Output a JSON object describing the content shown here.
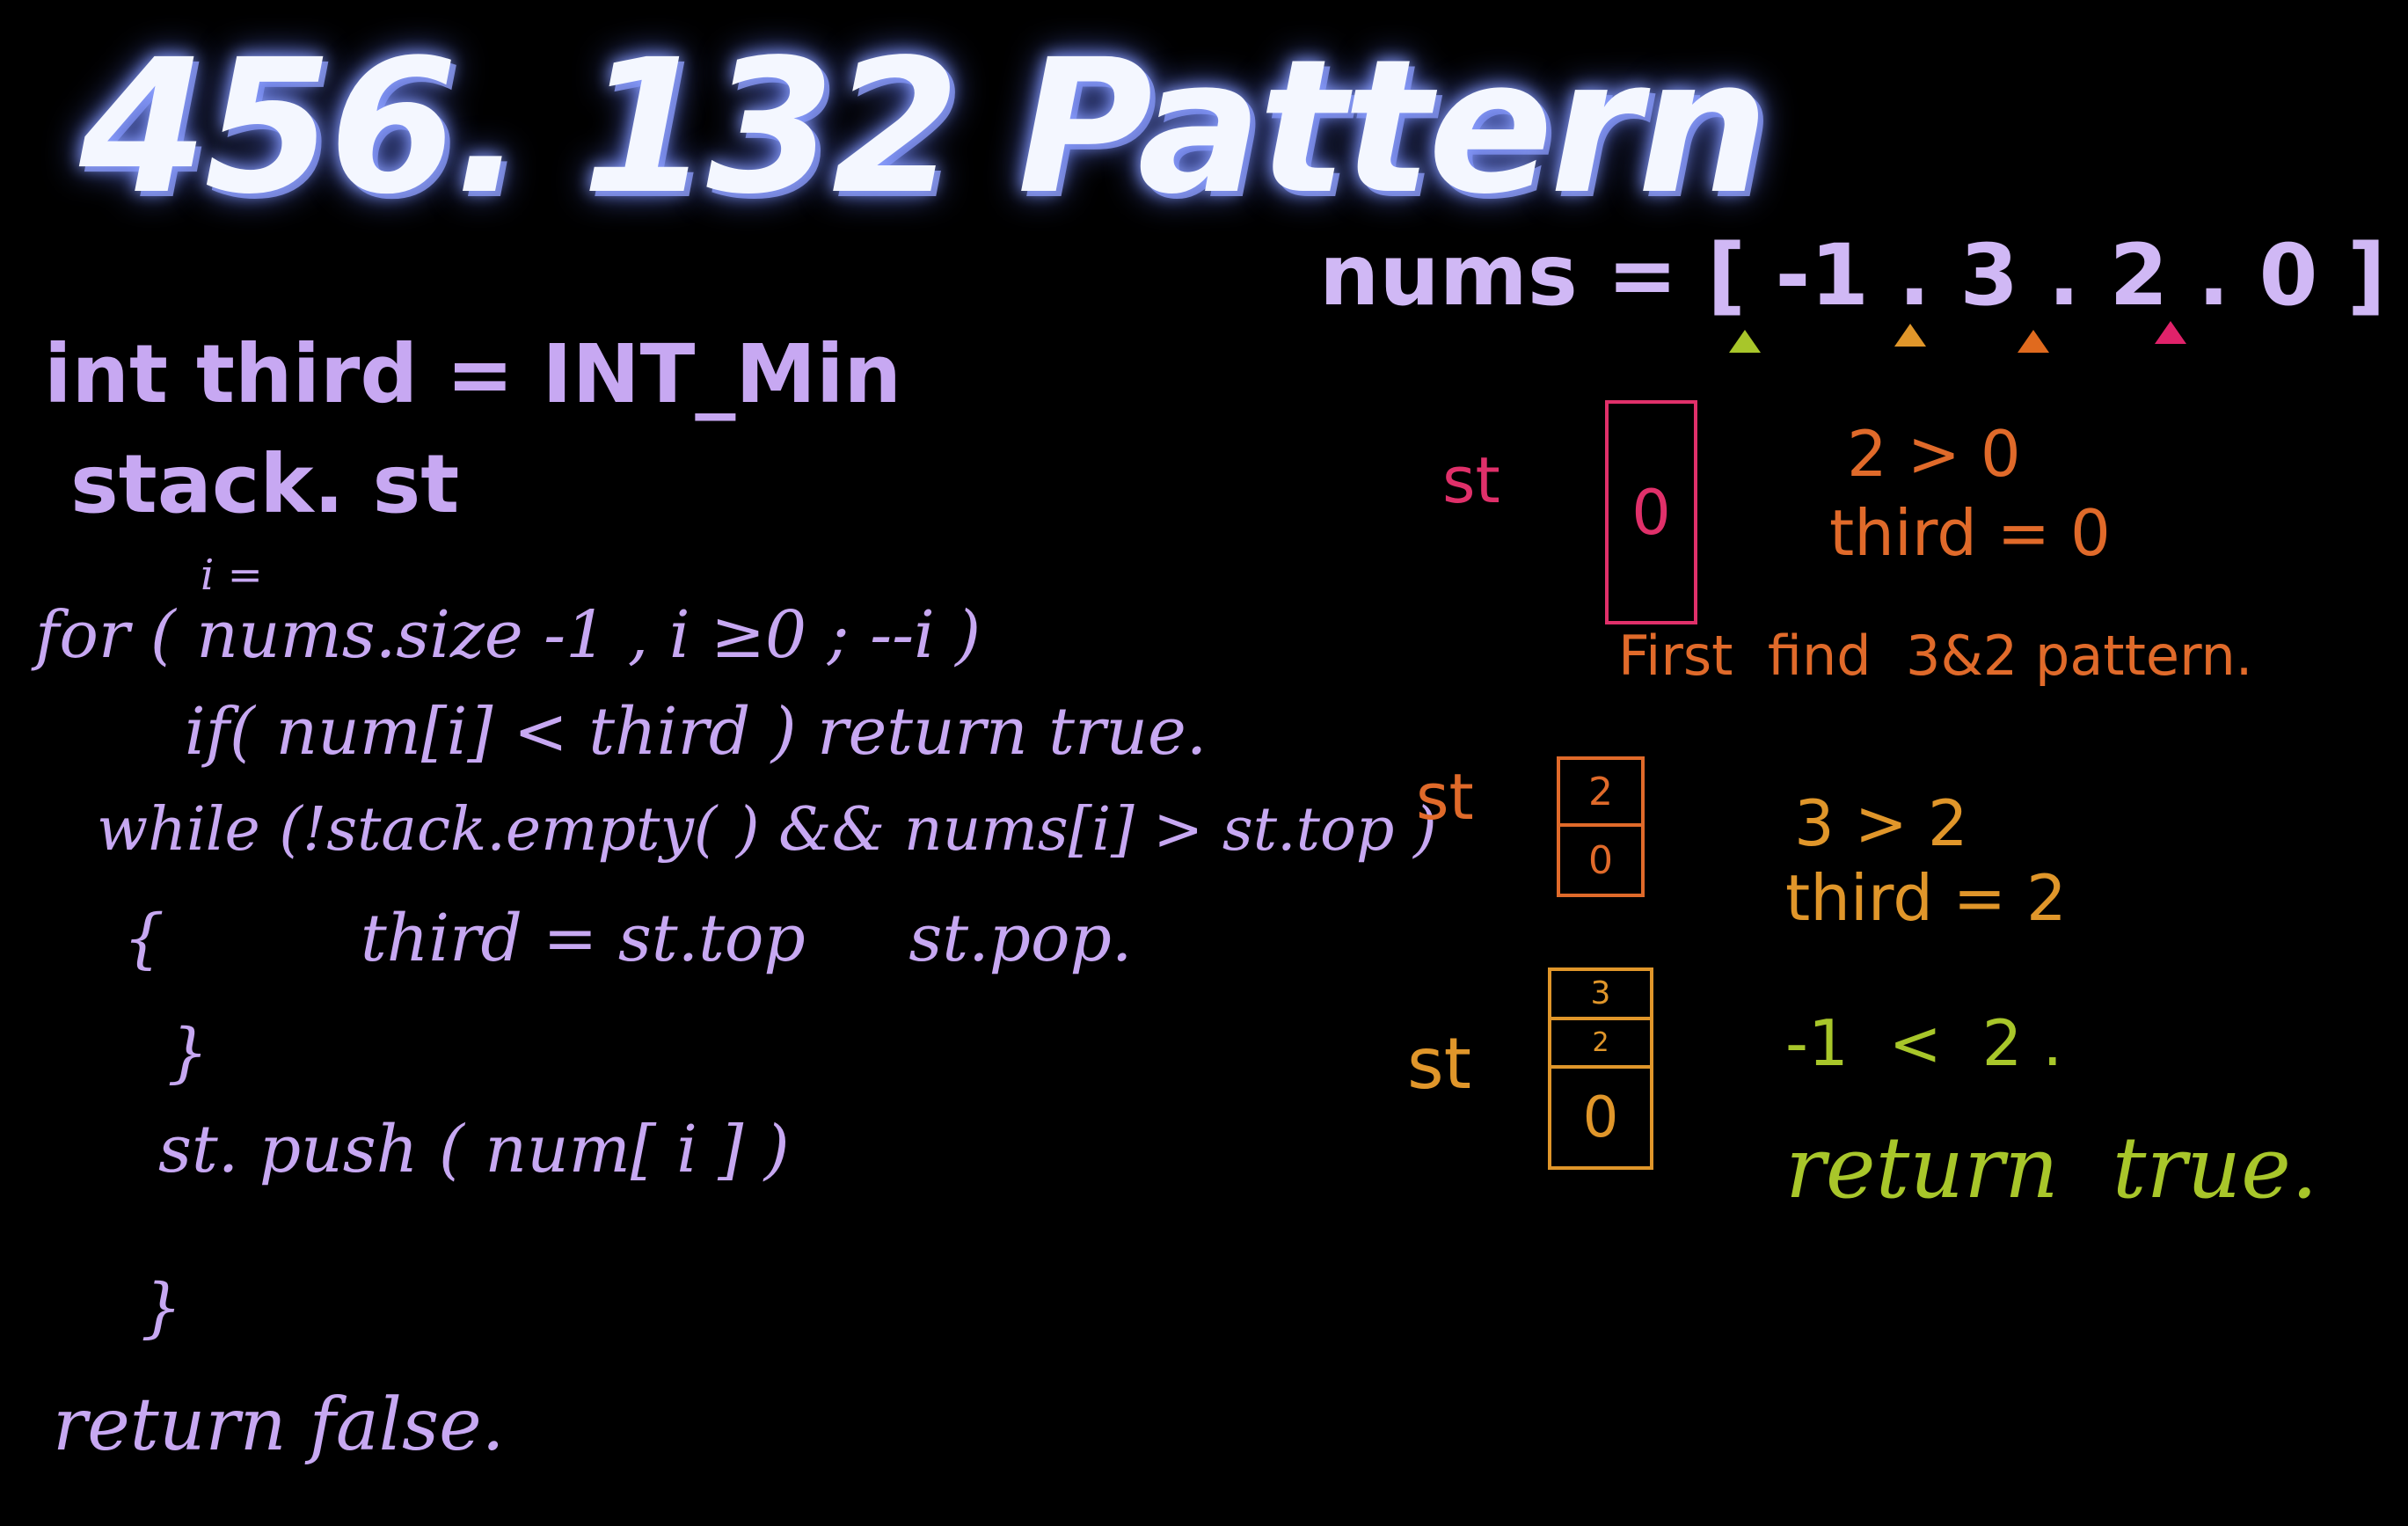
{
  "title": "456. 132 Pattern",
  "code": {
    "line1": "int third = INT_Min",
    "line2": "stack. st",
    "i_eq": "i =",
    "line3": "for ( nums.size -1 , i ≥0 ; --i )",
    "line4": "if( num[i] < third ) return true.",
    "line5": "while (!stack.empty( ) && nums[i] > st.top )",
    "brace_open": "{",
    "line6": "third = st.top     st.pop.",
    "brace_close_inner": "}",
    "line7": "st. push ( num[ i ] )",
    "brace_close_outer": "}",
    "line8": "return false."
  },
  "nums": {
    "label": "nums = [ -1 . 3 . 2 . 0 ]",
    "arrow_colors": [
      "#a8c62a",
      "#e0962a",
      "#e06a1e",
      "#e0226a"
    ]
  },
  "steps": [
    {
      "label": "st",
      "label_color": "#e0306a",
      "box_color": "#e0306a",
      "cells": [
        "0"
      ],
      "notes": [
        "2 > 0",
        "third = 0"
      ],
      "note_color": "#e06a2a"
    },
    {
      "label": "st",
      "label_color": "#e06a2a",
      "box_color": "#e06a2a",
      "cells": [
        "2",
        "0"
      ],
      "notes": [
        "3 > 2",
        "third = 2"
      ],
      "note_color": "#e0962a"
    },
    {
      "label": "st",
      "label_color": "#e0962a",
      "box_color": "#e0962a",
      "cells": [
        "3",
        "2",
        "0"
      ],
      "notes": [
        "-1  <  2 .",
        "return  true."
      ],
      "note_color": "#a8c62a"
    }
  ],
  "hint": "First  find  3&2 pattern."
}
